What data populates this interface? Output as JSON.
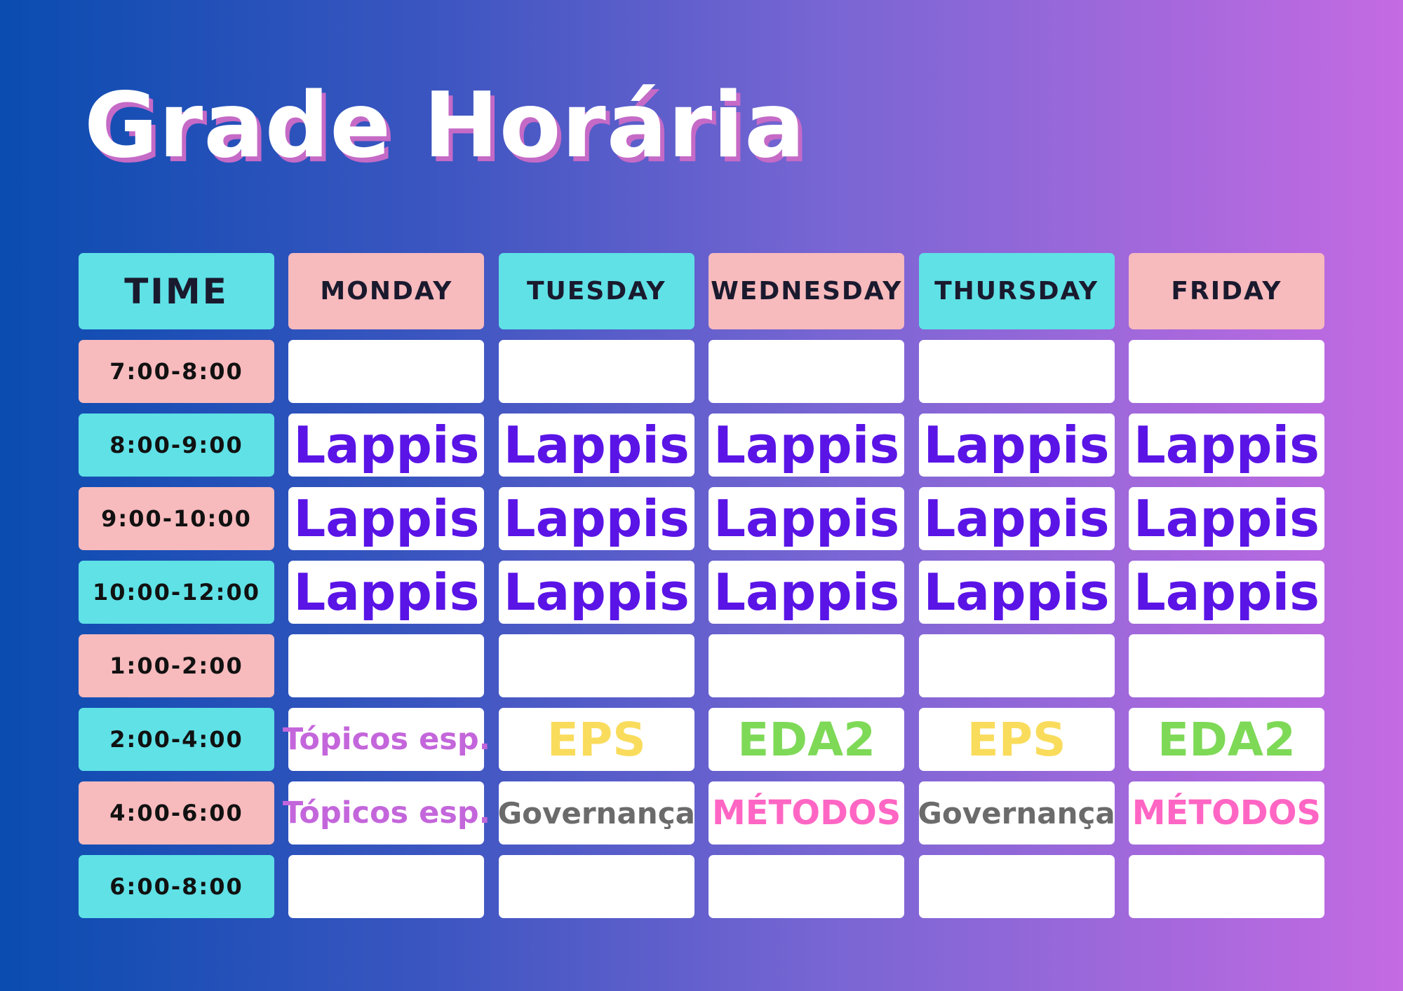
{
  "title": "Grade Horária",
  "colors": {
    "pink": "#f7babd",
    "cyan": "#5fe1e6",
    "lappis": "#5a14e6",
    "topicos": "#c466db",
    "eps": "#f9dc5c",
    "eda2": "#7ed957",
    "governanca": "#6b6b6b",
    "metodos": "#ff66c4"
  },
  "header": {
    "time": "TIME",
    "days": [
      "MONDAY",
      "TUESDAY",
      "WEDNESDAY",
      "THURSDAY",
      "FRIDAY"
    ]
  },
  "rows": [
    {
      "time": "7:00-8:00",
      "cells": [
        "",
        "",
        "",
        "",
        ""
      ]
    },
    {
      "time": "8:00-9:00",
      "cells": [
        "Lappis",
        "Lappis",
        "Lappis",
        "Lappis",
        "Lappis"
      ]
    },
    {
      "time": "9:00-10:00",
      "cells": [
        "Lappis",
        "Lappis",
        "Lappis",
        "Lappis",
        "Lappis"
      ]
    },
    {
      "time": "10:00-12:00",
      "cells": [
        "Lappis",
        "Lappis",
        "Lappis",
        "Lappis",
        "Lappis"
      ]
    },
    {
      "time": "1:00-2:00",
      "cells": [
        "",
        "",
        "",
        "",
        ""
      ]
    },
    {
      "time": "2:00-4:00",
      "cells": [
        "Tópicos esp.",
        "EPS",
        "EDA2",
        "EPS",
        "EDA2"
      ]
    },
    {
      "time": "4:00-6:00",
      "cells": [
        "Tópicos esp.",
        "Governança",
        "MÉTODOS",
        "Governança",
        "MÉTODOS"
      ]
    },
    {
      "time": "6:00-8:00",
      "cells": [
        "",
        "",
        "",
        "",
        ""
      ]
    }
  ]
}
